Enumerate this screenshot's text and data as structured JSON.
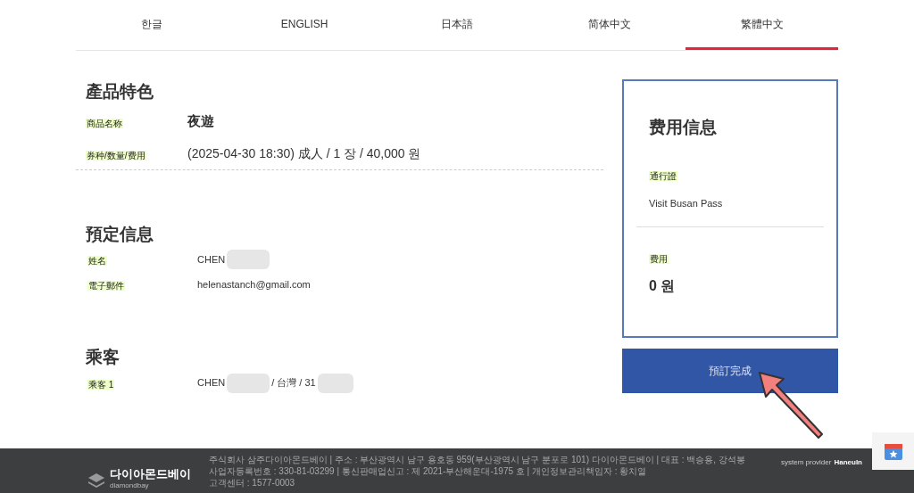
{
  "tabs": [
    {
      "label": "한글",
      "selected": false
    },
    {
      "label": "ENGLISH",
      "selected": false
    },
    {
      "label": "日本語",
      "selected": false
    },
    {
      "label": "简体中文",
      "selected": false
    },
    {
      "label": "繁體中文",
      "selected": true
    }
  ],
  "product": {
    "title": "產品特色",
    "rows": [
      {
        "label": "商品名称",
        "value": "夜遊",
        "kind": "bold"
      },
      {
        "label": "券种/数量/费用",
        "value": "(2025-04-30 18:30) 成人 / 1 장 / 40,000 원",
        "kind": "plain"
      }
    ]
  },
  "booking": {
    "title": "預定信息",
    "rows": [
      {
        "label": "姓名",
        "parts": [
          "CHEN"
        ]
      },
      {
        "label": "電子郵件",
        "parts": [
          "helenastanch@gmail.com"
        ]
      }
    ]
  },
  "passengers": {
    "title": "乘客",
    "rows": [
      {
        "label": "乘客 1",
        "parts": [
          "CHEN",
          "/ 台灣 / 31"
        ]
      }
    ]
  },
  "fee_card": {
    "title": "费用信息",
    "pass_label": "通行證",
    "pass_value": "Visit Busan Pass",
    "fee_label": "费用",
    "fee_value": "0 원"
  },
  "submit_button": "預訂完成",
  "footer": {
    "logo": "다이아몬드베이",
    "logo_sub": "diamondbay",
    "lines": [
      "주식회사 삼주다이아몬드베이 | 주소 : 부산광역시 남구 용호동 959(부산광역시 남구 분포로 101) 다이아몬드베이 | 대표 : 백승용, 강석봉",
      "사업자등록번호 : 330-81-03299 | 통신판매업신고 : 제 2021-부산해운대-1975 호 | 개인정보관리책임자 : 황치열",
      "고객센터 : 1577-0003"
    ],
    "provider": "system provider",
    "provider_name": "Haneuln"
  }
}
